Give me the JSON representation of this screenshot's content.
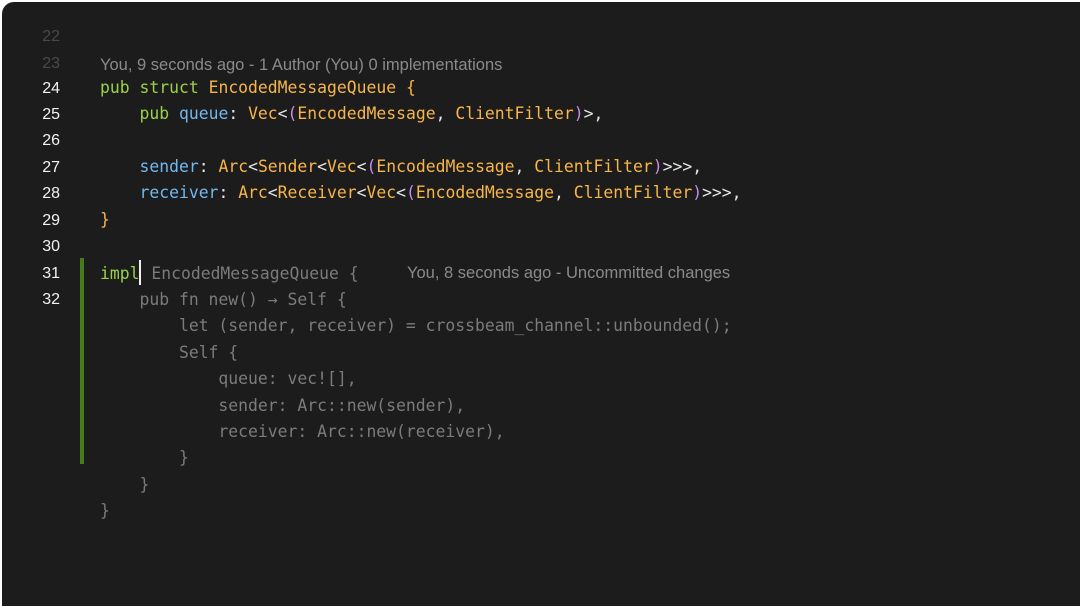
{
  "gutter": [
    "22",
    "23",
    "24",
    "25",
    "26",
    "27",
    "28",
    "29",
    "30",
    "31",
    "32"
  ],
  "blame": {
    "top": "You, 9 seconds ago - 1 Author (You) 0 implementations",
    "inline": "You, 8 seconds ago - Uncommitted changes"
  },
  "code": {
    "l24": [
      "pub",
      "struct",
      "EncodedMessageQueue",
      "{"
    ],
    "l25": [
      "pub",
      "queue",
      ":",
      "Vec",
      "<",
      "(",
      "EncodedMessage",
      ",",
      "ClientFilter",
      ")",
      ">,"
    ],
    "l27": [
      "sender",
      ":",
      "Arc",
      "<",
      "Sender",
      "<",
      "Vec",
      "<",
      "(",
      "EncodedMessage",
      ",",
      "ClientFilter",
      ")",
      ">>>,"
    ],
    "l28": [
      "receiver",
      ":",
      "Arc",
      "<",
      "Receiver",
      "<",
      "Vec",
      "<",
      "(",
      "EncodedMessage",
      ",",
      "ClientFilter",
      ")",
      ">>>,"
    ],
    "l29": "}",
    "l31_kw": "impl",
    "ghost": [
      "EncodedMessageQueue {",
      "pub fn new() → Self {",
      "let (sender, receiver) = crossbeam_channel::unbounded();",
      "Self {",
      "queue: vec![],",
      "sender: Arc::new(sender),",
      "receiver: Arc::new(receiver),",
      "}",
      "}",
      "}"
    ]
  },
  "colors": {
    "background": "#1c1c1c",
    "keyword": "#9ad14b",
    "type": "#f7b54a",
    "field": "#72b8ee",
    "paren": "#c88ae6",
    "ghost": "#7b7b7b",
    "change_bar": "#47791f"
  }
}
